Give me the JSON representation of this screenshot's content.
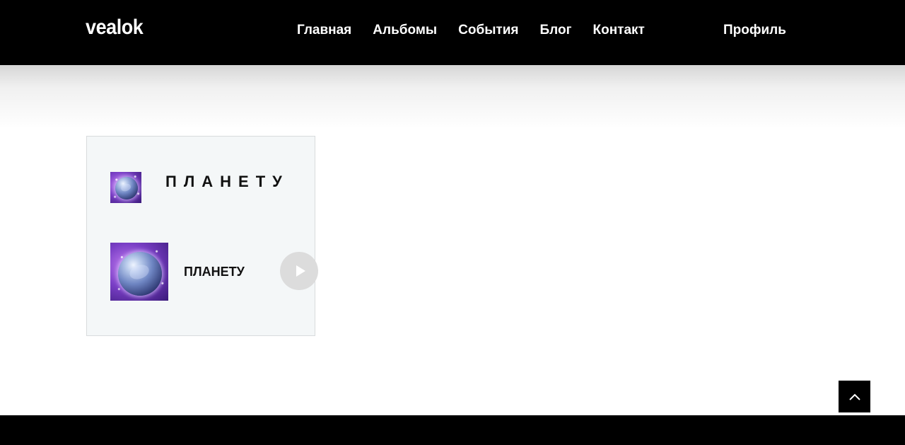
{
  "header": {
    "logo": "vealok",
    "nav": [
      "Главная",
      "Альбомы",
      "События",
      "Блог",
      "Контакт"
    ],
    "profile": "Профиль"
  },
  "album_card": {
    "title": "ПЛАНЕТУ",
    "track": {
      "title": "ПЛАНЕТУ",
      "cover_icon": "planet-cover-image",
      "play_icon": "play-icon"
    }
  },
  "scroll_top": {
    "icon": "chevron-up-icon"
  },
  "colors": {
    "header_bg": "#000000",
    "card_bg": "#f4f7f8",
    "play_button_bg": "#dcdcdc",
    "footer_bg": "#000000"
  }
}
